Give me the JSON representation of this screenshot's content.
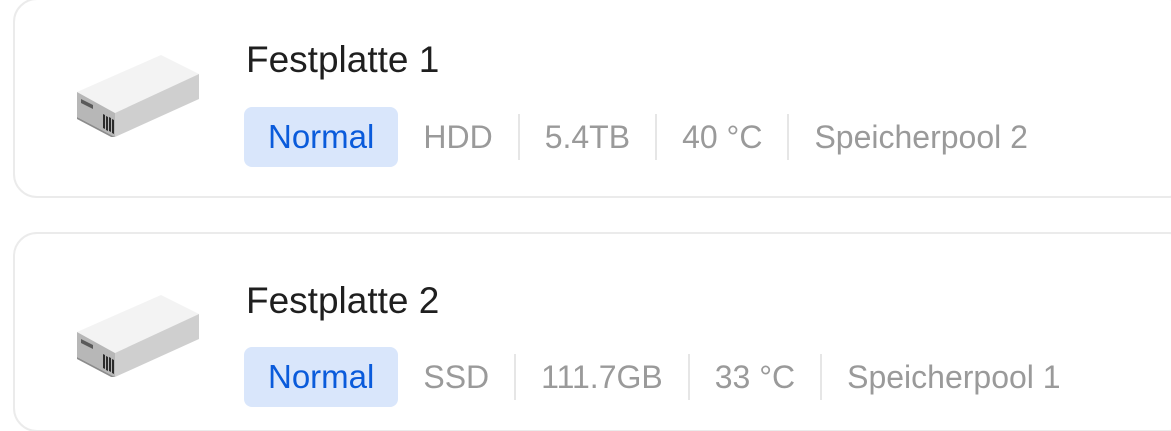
{
  "disks": [
    {
      "title": "Festplatte 1",
      "status": "Normal",
      "type": "HDD",
      "capacity": "5.4TB",
      "temperature": "40 °C",
      "pool": "Speicherpool 2",
      "icon": "hard-drive-icon"
    },
    {
      "title": "Festplatte 2",
      "status": "Normal",
      "type": "SSD",
      "capacity": "111.7GB",
      "temperature": "33 °C",
      "pool": "Speicherpool 1",
      "icon": "hard-drive-icon"
    }
  ],
  "colors": {
    "status_bg": "#d9e6fb",
    "status_text": "#0a5bdb",
    "meta_text": "#9a9a9a",
    "title_text": "#1f1f1f"
  }
}
